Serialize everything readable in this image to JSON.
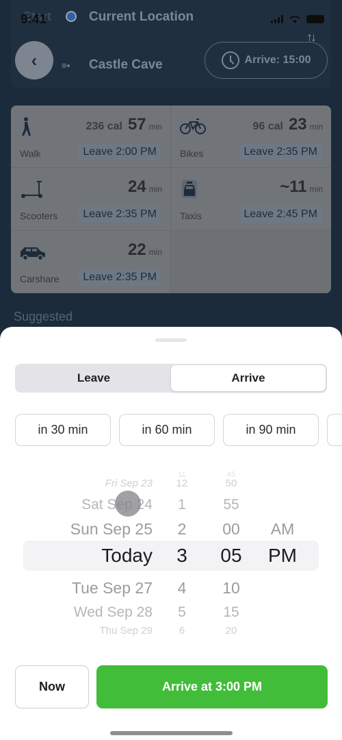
{
  "status_bar": {
    "time": "9:41"
  },
  "header": {
    "start_label": "Start",
    "start_location": "Current Location",
    "destination": "Castle Cave",
    "arrive_pill": "Arrive: 15:00",
    "back_icon": "chevron-left-icon",
    "swap_icon": "swap-arrows-icon"
  },
  "modes": [
    {
      "name": "Walk",
      "icon": "walk-icon",
      "calories": "236 cal",
      "minutes": "57",
      "unit": "min",
      "leave": "Leave 2:00 PM"
    },
    {
      "name": "Bikes",
      "icon": "bike-icon",
      "calories": "96 cal",
      "minutes": "23",
      "unit": "min",
      "leave": "Leave 2:35 PM"
    },
    {
      "name": "Scooters",
      "icon": "scooter-icon",
      "calories": "",
      "minutes": "24",
      "unit": "min",
      "leave": "Leave 2:35 PM"
    },
    {
      "name": "Taxis",
      "icon": "taxi-icon",
      "calories": "",
      "minutes": "~11",
      "unit": "min",
      "leave": "Leave 2:45 PM"
    },
    {
      "name": "Carshare",
      "icon": "car-icon",
      "calories": "",
      "minutes": "22",
      "unit": "min",
      "leave": "Leave 2:35 PM"
    }
  ],
  "suggested_label": "Suggested",
  "sheet": {
    "segment": {
      "options": [
        "Leave",
        "Arrive"
      ],
      "selected": "Arrive"
    },
    "quick_options": [
      "in 30 min",
      "in 60 min",
      "in 90 min",
      ""
    ],
    "picker": {
      "dates": [
        "",
        "Fri Sep 23",
        "Sat Sep 24",
        "Sun Sep 25",
        "Today",
        "Tue Sep 27",
        "Wed Sep 28",
        "Thu Sep 29"
      ],
      "hours": [
        "11",
        "12",
        "1",
        "2",
        "3",
        "4",
        "5",
        "6"
      ],
      "minutes": [
        "45",
        "50",
        "55",
        "00",
        "05",
        "10",
        "15",
        "20"
      ],
      "ampm": [
        "",
        "",
        "",
        "AM",
        "PM",
        "",
        "",
        ""
      ],
      "selected": {
        "date": "Today",
        "hour": "3",
        "minute": "05",
        "ampm": "PM"
      }
    },
    "now_button": "Now",
    "confirm_button": "Arrive at 3:00 PM",
    "confirm_color": "#42bd3a"
  }
}
